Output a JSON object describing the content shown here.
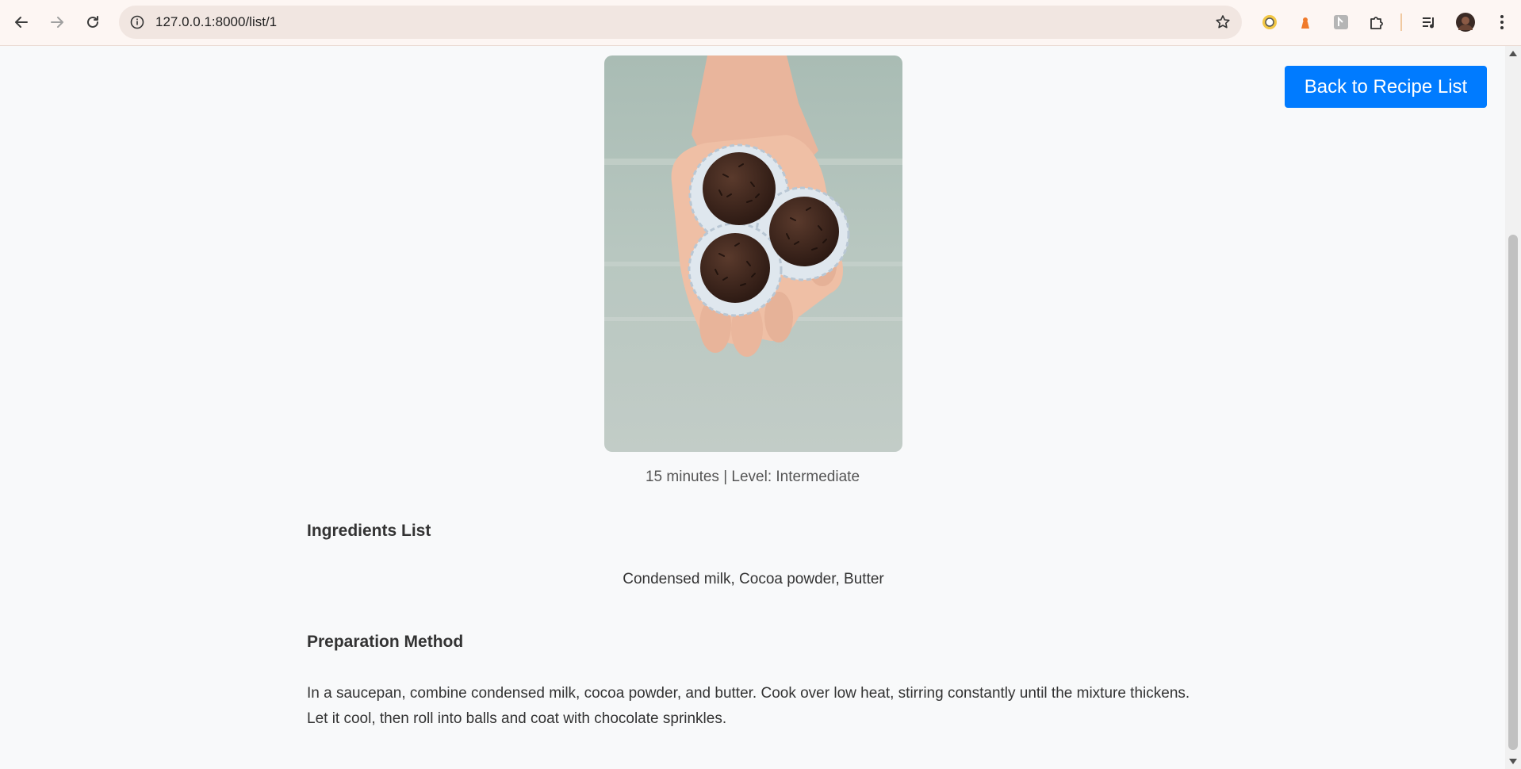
{
  "browser": {
    "url": "127.0.0.1:8000/list/1",
    "icons": {
      "back": "arrow-left-icon",
      "forward": "arrow-right-icon",
      "reload": "reload-icon",
      "info": "info-icon",
      "bookmark": "star-icon",
      "extensions": "puzzle-icon",
      "media": "media-control-icon",
      "menu": "kebab-menu-icon"
    }
  },
  "page": {
    "back_button_label": "Back to Recipe List",
    "meta": "15 minutes | Level: Intermediate",
    "ingredients_heading": "Ingredients List",
    "ingredients_text": "Condensed milk, Cocoa powder, Butter",
    "method_heading": "Preparation Method",
    "method_text": "In a saucepan, combine condensed milk, cocoa powder, and butter. Cook over low heat, stirring constantly until the mixture thickens. Let it cool, then roll into balls and coat with chocolate sprinkles."
  },
  "colors": {
    "accent": "#007bff",
    "page_bg": "#f8f9fa",
    "chrome_bg": "#fdf6f3"
  }
}
